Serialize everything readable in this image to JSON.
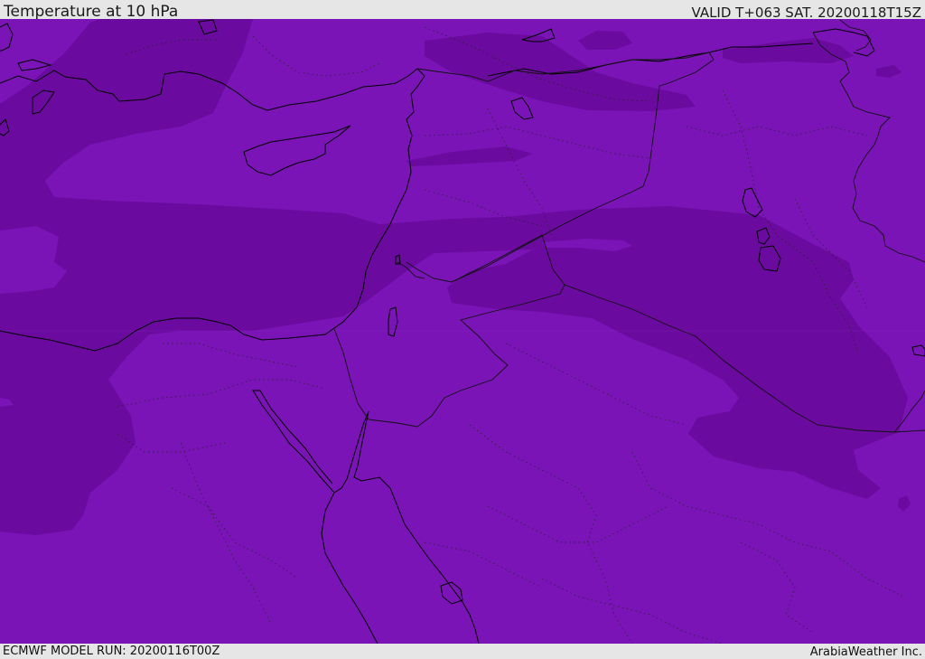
{
  "header": {
    "title": "Temperature at 10 hPa",
    "valid": "VALID T+063 SAT. 20200118T15Z"
  },
  "footer": {
    "model_run": "ECMWF MODEL RUN: 20200116T00Z",
    "credit": "ArabiaWeather Inc."
  },
  "map": {
    "colors": {
      "background_field": "#7a14b6",
      "colder_band": "#6a0a9e",
      "coastline": "#000000",
      "borders": "#111111"
    }
  }
}
